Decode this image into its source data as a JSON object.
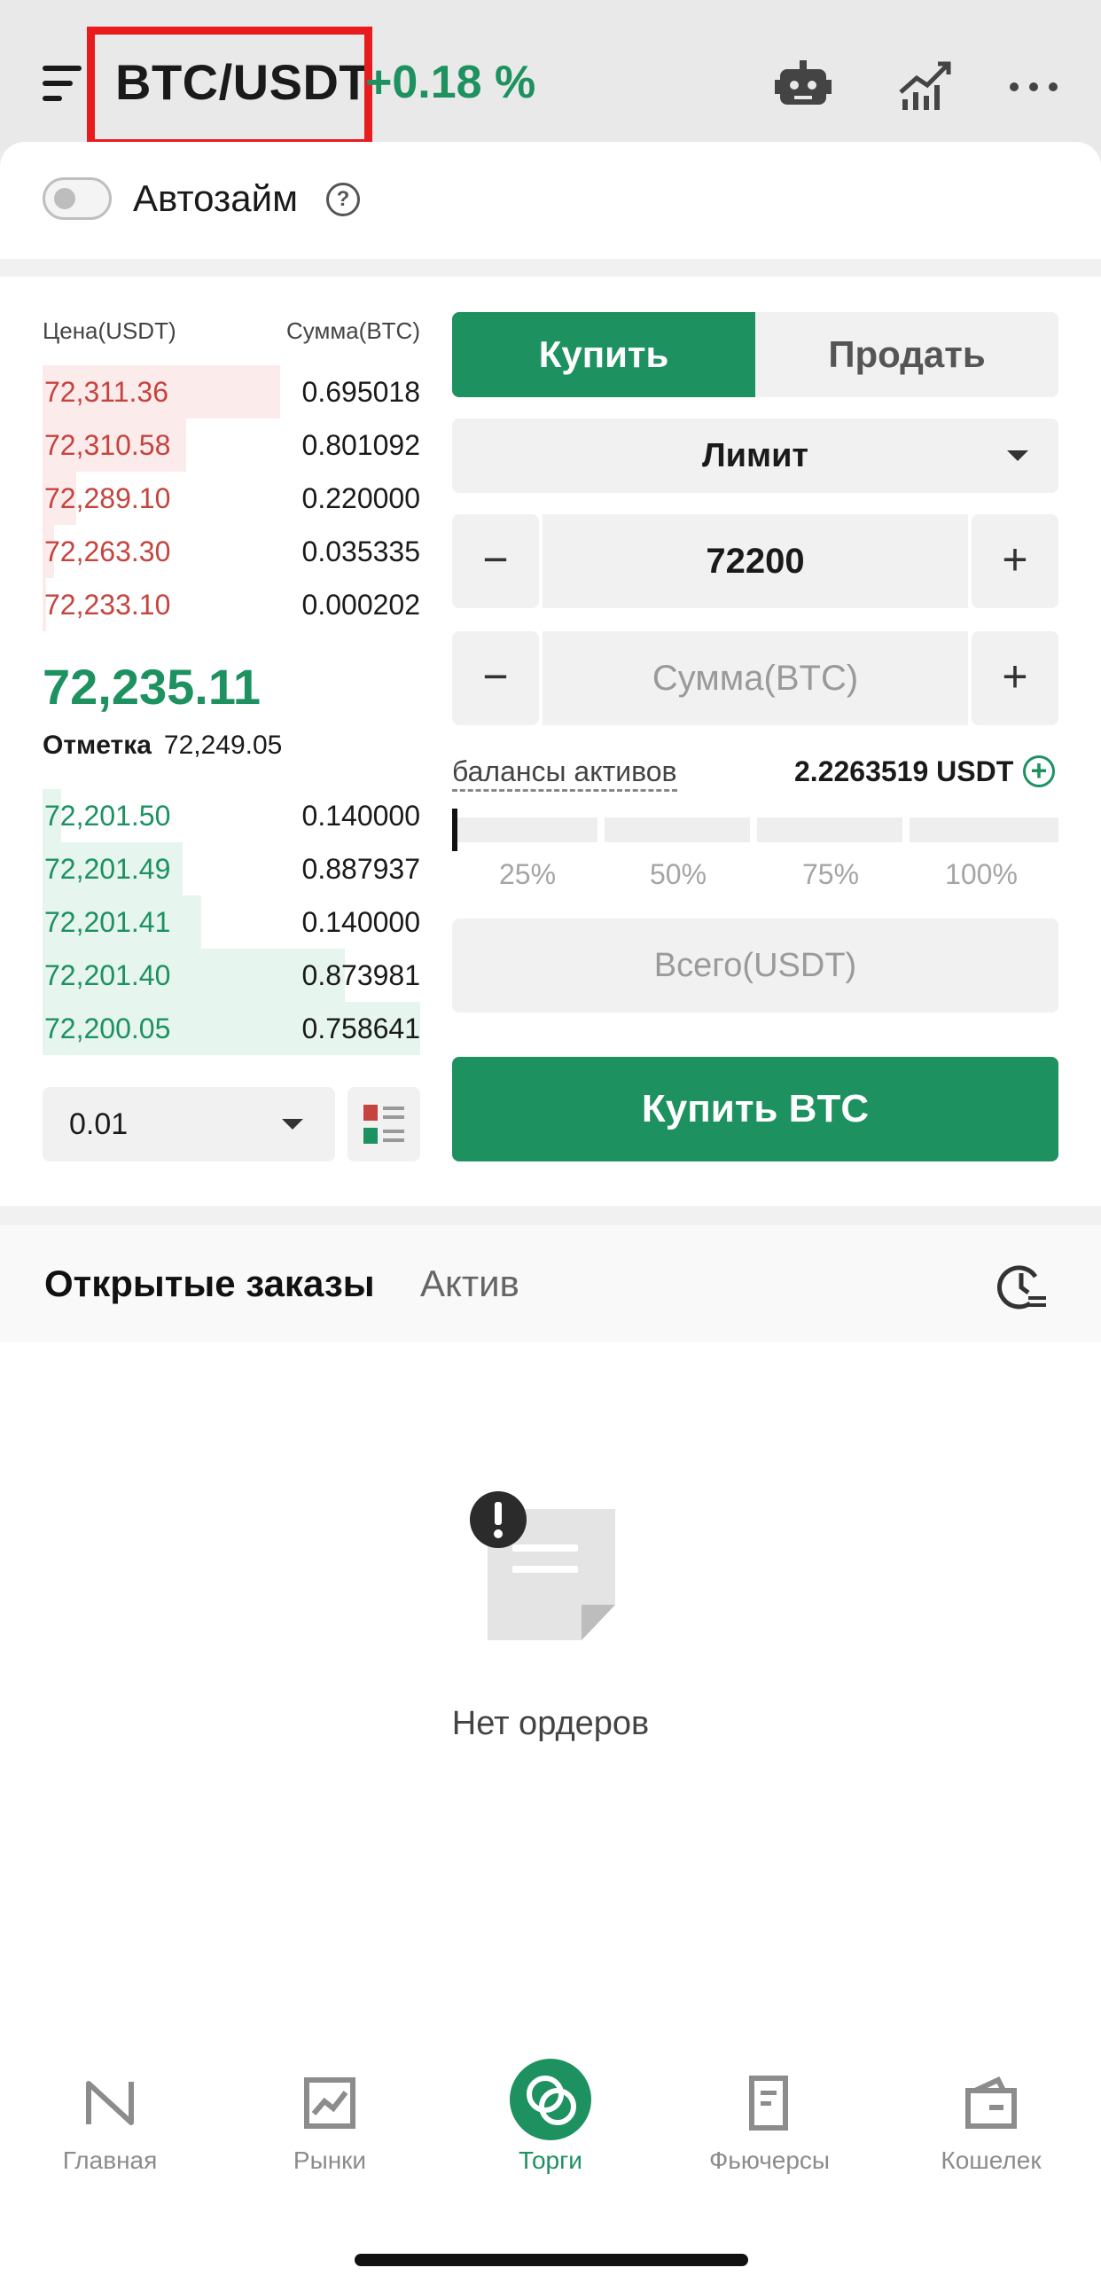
{
  "header": {
    "pair": "BTC/USDT",
    "change": "+0.18 %"
  },
  "autoloan": {
    "label": "Автозайм",
    "help": "?",
    "enabled": false
  },
  "orderbook": {
    "price_header": "Цена(USDT)",
    "amount_header": "Сумма(BTC)",
    "asks": [
      {
        "price": "72,311.36",
        "amount": "0.695018",
        "depth": 0.63
      },
      {
        "price": "72,310.58",
        "amount": "0.801092",
        "depth": 0.38
      },
      {
        "price": "72,289.10",
        "amount": "0.220000",
        "depth": 0.09
      },
      {
        "price": "72,263.30",
        "amount": "0.035335",
        "depth": 0.03
      },
      {
        "price": "72,233.10",
        "amount": "0.000202",
        "depth": 0.01
      }
    ],
    "last_price": "72,235.11",
    "mark_label": "Отметка",
    "mark_price": "72,249.05",
    "bids": [
      {
        "price": "72,201.50",
        "amount": "0.140000",
        "depth": 0.05
      },
      {
        "price": "72,201.49",
        "amount": "0.887937",
        "depth": 0.37
      },
      {
        "price": "72,201.41",
        "amount": "0.140000",
        "depth": 0.42
      },
      {
        "price": "72,201.40",
        "amount": "0.873981",
        "depth": 0.8
      },
      {
        "price": "72,200.05",
        "amount": "0.758641",
        "depth": 1.0
      }
    ],
    "precision": "0.01"
  },
  "form": {
    "buy_tab": "Купить",
    "sell_tab": "Продать",
    "order_type": "Лимит",
    "price_value": "72200",
    "amount_placeholder": "Сумма(BTC)",
    "minus": "−",
    "plus": "+",
    "balance_label": "балансы активов",
    "balance_value": "2.2263519 USDT",
    "balance_add": "+",
    "percent_options": [
      "25%",
      "50%",
      "75%",
      "100%"
    ],
    "slider_value": 0,
    "total_placeholder": "Всего(USDT)",
    "buy_button": "Купить BTC"
  },
  "orders": {
    "tab_open": "Открытые заказы",
    "tab_assets": "Актив",
    "empty_text": "Нет ордеров"
  },
  "nav": {
    "items": [
      {
        "label": "Главная",
        "icon": "home-n-icon"
      },
      {
        "label": "Рынки",
        "icon": "markets-chart-icon"
      },
      {
        "label": "Торги",
        "icon": "trade-icon"
      },
      {
        "label": "Фьючерсы",
        "icon": "futures-doc-icon"
      },
      {
        "label": "Кошелек",
        "icon": "wallet-icon"
      }
    ]
  },
  "colors": {
    "accent_green": "#1d9160",
    "ask_red": "#c5443f",
    "highlight_red": "#e81c1c"
  }
}
